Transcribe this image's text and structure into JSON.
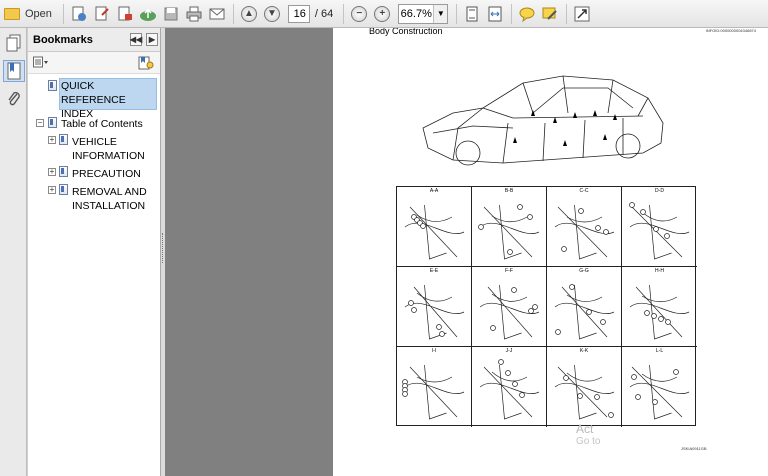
{
  "toolbar": {
    "open_label": "Open",
    "page_current": "16",
    "page_total": "/ 64",
    "zoom": "66.7%"
  },
  "bookmarks": {
    "title": "Bookmarks",
    "items": [
      {
        "label": "QUICK REFERENCE INDEX",
        "line1": "QUICK REFERENCE",
        "line2": "INDEX",
        "selected": true
      },
      {
        "label": "Table of Contents"
      },
      {
        "label": "VEHICLE INFORMATION",
        "line1": "VEHICLE",
        "line2": "INFORMATION"
      },
      {
        "label": "PRECAUTION"
      },
      {
        "label": "REMOVAL AND INSTALLATION",
        "line1": "REMOVAL AND",
        "line2": "INSTALLATION"
      }
    ]
  },
  "document": {
    "page_title": "Body Construction",
    "header_code": "INFOID:0000000004346874",
    "footer_code": "JSKIA0911GB",
    "sections": [
      "A-A",
      "B-B",
      "C-C",
      "D-D",
      "E-E",
      "F-F",
      "G-G",
      "H-H",
      "I-I",
      "J-J",
      "K-K",
      "L-L"
    ]
  },
  "watermark": {
    "line1": "Act",
    "line2": "Go to"
  },
  "icons": [
    "open-folder-icon",
    "convert-icon",
    "create-icon",
    "upload-icon",
    "save-icon",
    "print-icon",
    "email-icon",
    "previous-page-icon",
    "next-page-icon",
    "zoom-out-icon",
    "zoom-in-icon",
    "fit-page-icon",
    "fit-width-icon",
    "comment-icon",
    "highlight-icon",
    "expand-icon",
    "pages-icon",
    "bookmarks-icon",
    "attachments-icon"
  ]
}
